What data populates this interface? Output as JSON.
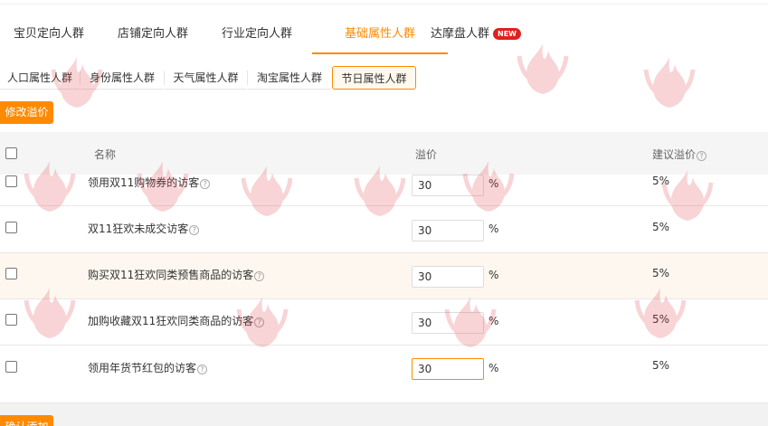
{
  "main_tabs": [
    {
      "label": "宝贝定向人群"
    },
    {
      "label": "店铺定向人群"
    },
    {
      "label": "行业定向人群"
    },
    {
      "label": "基础属性人群",
      "active": true
    },
    {
      "label": "达摩盘人群",
      "badge": "NEW"
    }
  ],
  "sub_tabs": [
    {
      "label": "人口属性人群"
    },
    {
      "label": "身份属性人群"
    },
    {
      "label": "天气属性人群"
    },
    {
      "label": "淘宝属性人群"
    },
    {
      "label": "节日属性人群",
      "active": true
    }
  ],
  "toolbar": {
    "modify_label": "修改溢价"
  },
  "table": {
    "headers": {
      "name": "名称",
      "premium": "溢价",
      "suggested": "建议溢价"
    },
    "rows": [
      {
        "name": "领用双11购物券的访客",
        "premium": "30",
        "unit": "%",
        "suggested": "5%"
      },
      {
        "name": "双11狂欢未成交访客",
        "premium": "30",
        "unit": "%",
        "suggested": "5%"
      },
      {
        "name": "购买双11狂欢同类预售商品的访客",
        "premium": "30",
        "unit": "%",
        "suggested": "5%"
      },
      {
        "name": "加购收藏双11狂欢同类商品的访客",
        "premium": "30",
        "unit": "%",
        "suggested": "5%"
      },
      {
        "name": "领用年货节红包的访客",
        "premium": "30",
        "unit": "%",
        "suggested": "5%"
      }
    ]
  },
  "footer": {
    "confirm_label": "确认添加"
  },
  "icons": {
    "help": "help-circle-icon",
    "watermark": "flame-logo-watermark"
  },
  "colors": {
    "accent": "#ff8a00",
    "badge": "#e02020",
    "hover_row": "#fdf7ef"
  }
}
